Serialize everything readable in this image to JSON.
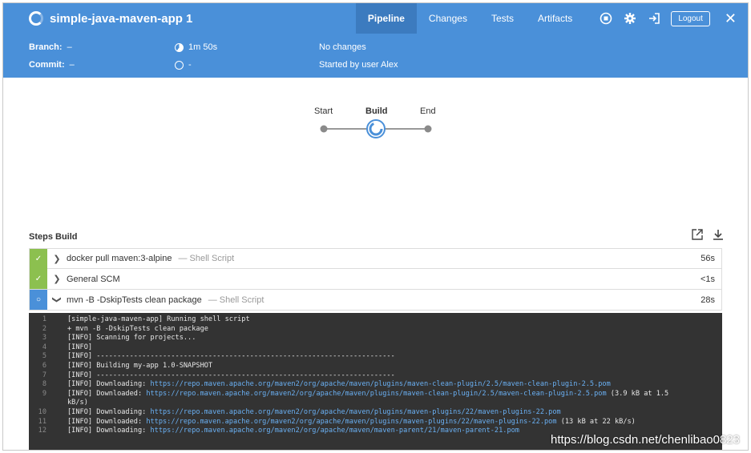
{
  "header": {
    "title": "simple-java-maven-app 1",
    "tabs": [
      "Pipeline",
      "Changes",
      "Tests",
      "Artifacts"
    ],
    "active_tab": "Pipeline",
    "logout_label": "Logout",
    "icons": [
      "stop-icon",
      "gear-icon",
      "exit-icon",
      "close-icon"
    ],
    "accent_color": "#4a90d9"
  },
  "run": {
    "branch_label": "Branch:",
    "branch_value": "–",
    "commit_label": "Commit:",
    "commit_value": "–",
    "duration": "1m 50s",
    "time_value": "-",
    "changes": "No changes",
    "started_by": "Started by user Alex"
  },
  "graph": {
    "stages": [
      "Start",
      "Build",
      "End"
    ],
    "active_stage": "Build"
  },
  "steps": {
    "title": "Steps Build",
    "items": [
      {
        "name": "docker pull maven:3-alpine",
        "type": "— Shell Script",
        "duration": "56s",
        "status": "success"
      },
      {
        "name": "General SCM",
        "type": "",
        "duration": "<1s",
        "status": "success"
      },
      {
        "name": "mvn -B -DskipTests clean package",
        "type": "— Shell Script",
        "duration": "28s",
        "status": "running"
      }
    ]
  },
  "console": {
    "lines": [
      {
        "n": "1",
        "text": "[simple-java-maven-app] Running shell script",
        "link": "",
        "suffix": ""
      },
      {
        "n": "2",
        "text": "+ mvn -B -DskipTests clean package",
        "link": "",
        "suffix": ""
      },
      {
        "n": "3",
        "text": "[INFO] Scanning for projects...",
        "link": "",
        "suffix": ""
      },
      {
        "n": "4",
        "text": "[INFO]",
        "link": "",
        "suffix": ""
      },
      {
        "n": "5",
        "text": "[INFO] ------------------------------------------------------------------------",
        "link": "",
        "suffix": ""
      },
      {
        "n": "6",
        "text": "[INFO] Building my-app 1.0-SNAPSHOT",
        "link": "",
        "suffix": ""
      },
      {
        "n": "7",
        "text": "[INFO] ------------------------------------------------------------------------",
        "link": "",
        "suffix": ""
      },
      {
        "n": "8",
        "text": "[INFO] Downloading: ",
        "link": "https://repo.maven.apache.org/maven2/org/apache/maven/plugins/maven-clean-plugin/2.5/maven-clean-plugin-2.5.pom",
        "suffix": ""
      },
      {
        "n": "9",
        "text": "[INFO] Downloaded: ",
        "link": "https://repo.maven.apache.org/maven2/org/apache/maven/plugins/maven-clean-plugin/2.5/maven-clean-plugin-2.5.pom",
        "suffix": " (3.9 kB at 1.5 kB/s)"
      },
      {
        "n": "10",
        "text": "[INFO] Downloading: ",
        "link": "https://repo.maven.apache.org/maven2/org/apache/maven/plugins/maven-plugins/22/maven-plugins-22.pom",
        "suffix": ""
      },
      {
        "n": "11",
        "text": "[INFO] Downloaded: ",
        "link": "https://repo.maven.apache.org/maven2/org/apache/maven/plugins/maven-plugins/22/maven-plugins-22.pom",
        "suffix": " (13 kB at 22 kB/s)"
      },
      {
        "n": "12",
        "text": "[INFO] Downloading: ",
        "link": "https://repo.maven.apache.org/maven2/org/apache/maven/maven-parent/21/maven-parent-21.pom",
        "suffix": ""
      }
    ]
  },
  "watermark": "https://blog.csdn.net/chenlibao0823"
}
